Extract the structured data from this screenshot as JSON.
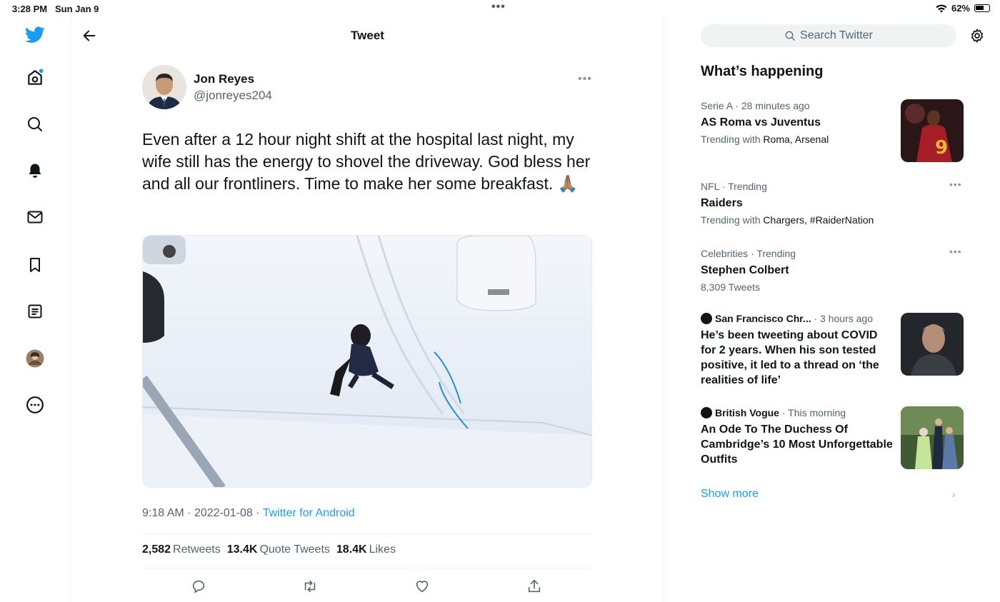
{
  "status_bar": {
    "time": "3:28 PM",
    "date": "Sun Jan 9",
    "battery": "62%"
  },
  "nav": {
    "items": [
      "twitter-logo",
      "home",
      "explore",
      "notifications",
      "messages",
      "bookmarks",
      "lists",
      "profile",
      "more"
    ]
  },
  "header": {
    "title": "Tweet"
  },
  "tweet": {
    "author_name": "Jon Reyes",
    "author_handle": "@jonreyes204",
    "text": "Even after a 12 hour night shift at the hospital last night, my wife still has the energy to shovel the driveway. God bless her and all our frontliners. Time to make her some breakfast. 🙏🏽",
    "time": "9:18 AM",
    "date": "2022-01-08",
    "source": "Twitter for Android",
    "retweets_count": "2,582",
    "retweets_label": "Retweets",
    "quotes_count": "13.4K",
    "quotes_label": "Quote Tweets",
    "likes_count": "18.4K",
    "likes_label": "Likes"
  },
  "sidebar": {
    "search_placeholder": "Search Twitter",
    "heading": "What’s happening",
    "trends": [
      {
        "context": "Serie A",
        "time": "· 28 minutes ago",
        "title": "AS Roma vs Juventus",
        "sub_prefix": "Trending with ",
        "sub_keys": "Roma, Arsenal"
      },
      {
        "context": "NFL · Trending",
        "title": "Raiders",
        "sub_prefix": "Trending with ",
        "sub_keys": "Chargers, #RaiderNation"
      },
      {
        "context": "Celebrities · Trending",
        "title": "Stephen Colbert",
        "sub": "8,309 Tweets"
      },
      {
        "publisher": "San Francisco Chr...",
        "time": "· 3 hours ago",
        "title": "He’s been tweeting about COVID for 2 years. When his son tested positive, it led to a thread on ‘the realities of life’"
      },
      {
        "publisher": "British Vogue",
        "time": "· This morning",
        "title": "An Ode To The Duchess Of Cambridge’s 10 Most Unforgettable Outfits"
      }
    ],
    "show_more": "Show more"
  },
  "colors": {
    "accent": "#1d9bf0",
    "text": "#0f1419",
    "secondary": "#536471"
  }
}
